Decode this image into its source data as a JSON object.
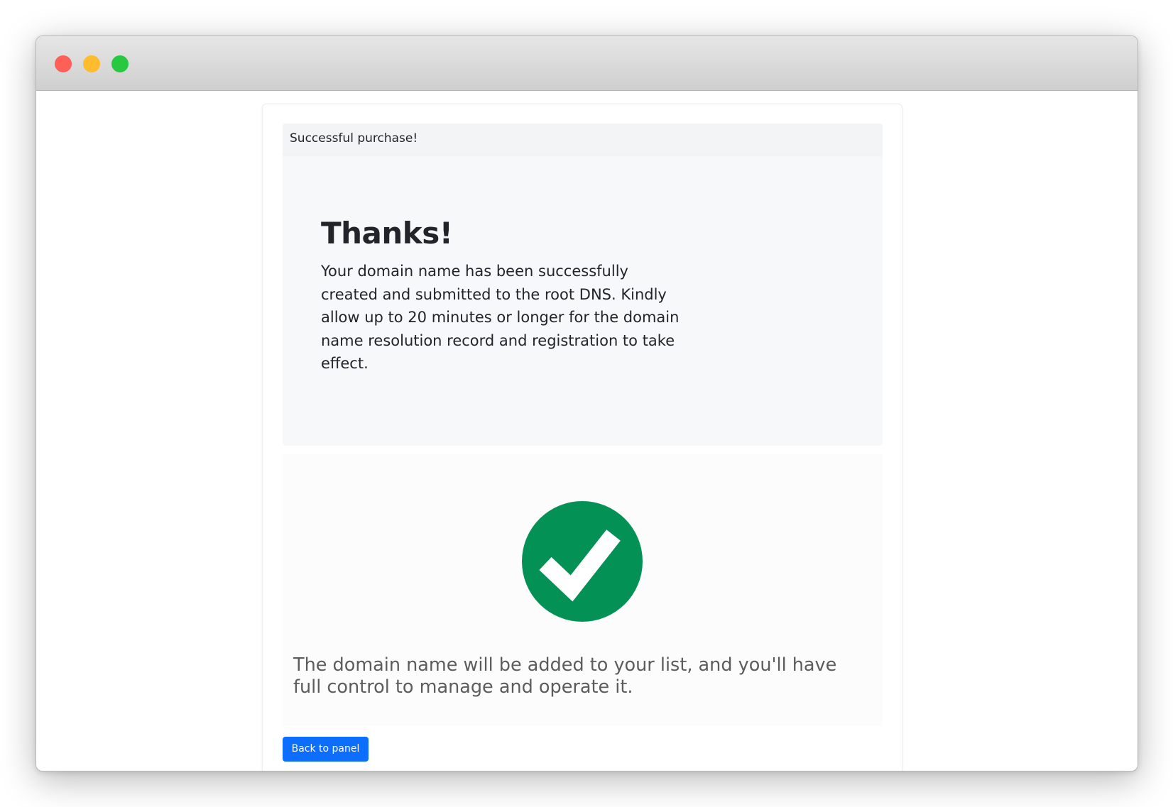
{
  "window": {
    "controls": [
      "close-icon",
      "minimize-icon",
      "maximize-icon"
    ],
    "control_colors": {
      "close": "#fe5f57",
      "minimize": "#febc2e",
      "maximize": "#28c840"
    }
  },
  "card": {
    "header": "Successful purchase!",
    "title": "Thanks!",
    "message": "Your domain name has been successfully created and submitted to the root DNS. Kindly allow up to 20 minutes or longer for the domain name resolution record and registration to take effect.",
    "status_icon": "check-circle-icon",
    "status_color": "#039155",
    "note": "The domain name will be added to your list, and you'll have full control to manage and operate it.",
    "back_button": "Back to panel",
    "button_color": "#0d6efd"
  }
}
